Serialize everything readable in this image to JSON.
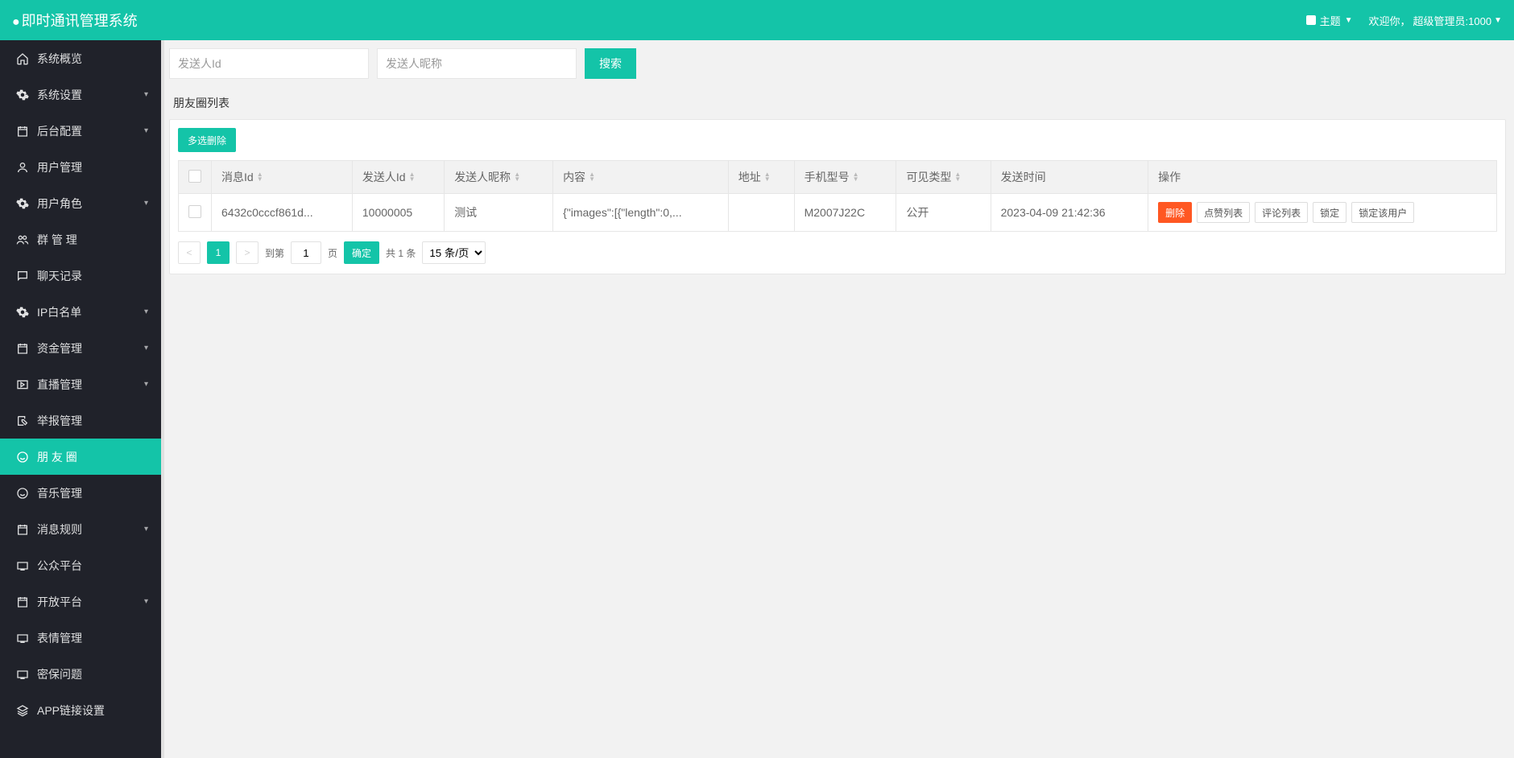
{
  "header": {
    "title": "即时通讯管理系统",
    "theme_label": "主题",
    "welcome_prefix": "欢迎你，",
    "user_name": "超级管理员:1000"
  },
  "sidebar": {
    "items": [
      {
        "label": "系统概览",
        "icon": "home",
        "expandable": false
      },
      {
        "label": "系统设置",
        "icon": "gear",
        "expandable": true
      },
      {
        "label": "后台配置",
        "icon": "calendar",
        "expandable": true
      },
      {
        "label": "用户管理",
        "icon": "user",
        "expandable": false
      },
      {
        "label": "用户角色",
        "icon": "gear",
        "expandable": true
      },
      {
        "label": "群 管 理",
        "icon": "group",
        "expandable": false
      },
      {
        "label": "聊天记录",
        "icon": "chat",
        "expandable": false
      },
      {
        "label": "IP白名单",
        "icon": "gear",
        "expandable": true
      },
      {
        "label": "资金管理",
        "icon": "calendar",
        "expandable": true
      },
      {
        "label": "直播管理",
        "icon": "play",
        "expandable": true
      },
      {
        "label": "举报管理",
        "icon": "edit",
        "expandable": false
      },
      {
        "label": "朋 友 圈",
        "icon": "smile",
        "expandable": false,
        "active": true
      },
      {
        "label": "音乐管理",
        "icon": "smile",
        "expandable": false
      },
      {
        "label": "消息规则",
        "icon": "calendar",
        "expandable": true
      },
      {
        "label": "公众平台",
        "icon": "tv",
        "expandable": false
      },
      {
        "label": "开放平台",
        "icon": "calendar",
        "expandable": true
      },
      {
        "label": "表情管理",
        "icon": "tv",
        "expandable": false
      },
      {
        "label": "密保问题",
        "icon": "tv",
        "expandable": false
      },
      {
        "label": "APP链接设置",
        "icon": "layers",
        "expandable": false
      }
    ]
  },
  "search": {
    "sender_id_placeholder": "发送人Id",
    "sender_nick_placeholder": "发送人昵称",
    "search_btn": "搜索"
  },
  "card": {
    "title": "朋友圈列表"
  },
  "toolbar": {
    "multi_delete": "多选删除"
  },
  "table": {
    "headers": {
      "msg_id": "消息Id",
      "sender_id": "发送人Id",
      "sender_nick": "发送人昵称",
      "content": "内容",
      "address": "地址",
      "phone_model": "手机型号",
      "visible_type": "可见类型",
      "send_time": "发送时间",
      "actions": "操作"
    },
    "rows": [
      {
        "msg_id": "6432c0cccf861d...",
        "sender_id": "10000005",
        "sender_nick": "测试",
        "content": "{\"images\":[{\"length\":0,...",
        "address": "",
        "phone_model": "M2007J22C",
        "visible_type": "公开",
        "send_time": "2023-04-09 21:42:36"
      }
    ],
    "row_actions": {
      "delete": "删除",
      "like_list": "点赞列表",
      "comment_list": "评论列表",
      "lock": "锁定",
      "lock_user": "锁定该用户"
    }
  },
  "pagination": {
    "current": "1",
    "goto_label": "到第",
    "page_suffix": "页",
    "page_input": "1",
    "confirm": "确定",
    "total": "共 1 条",
    "per_page": "15 条/页"
  }
}
